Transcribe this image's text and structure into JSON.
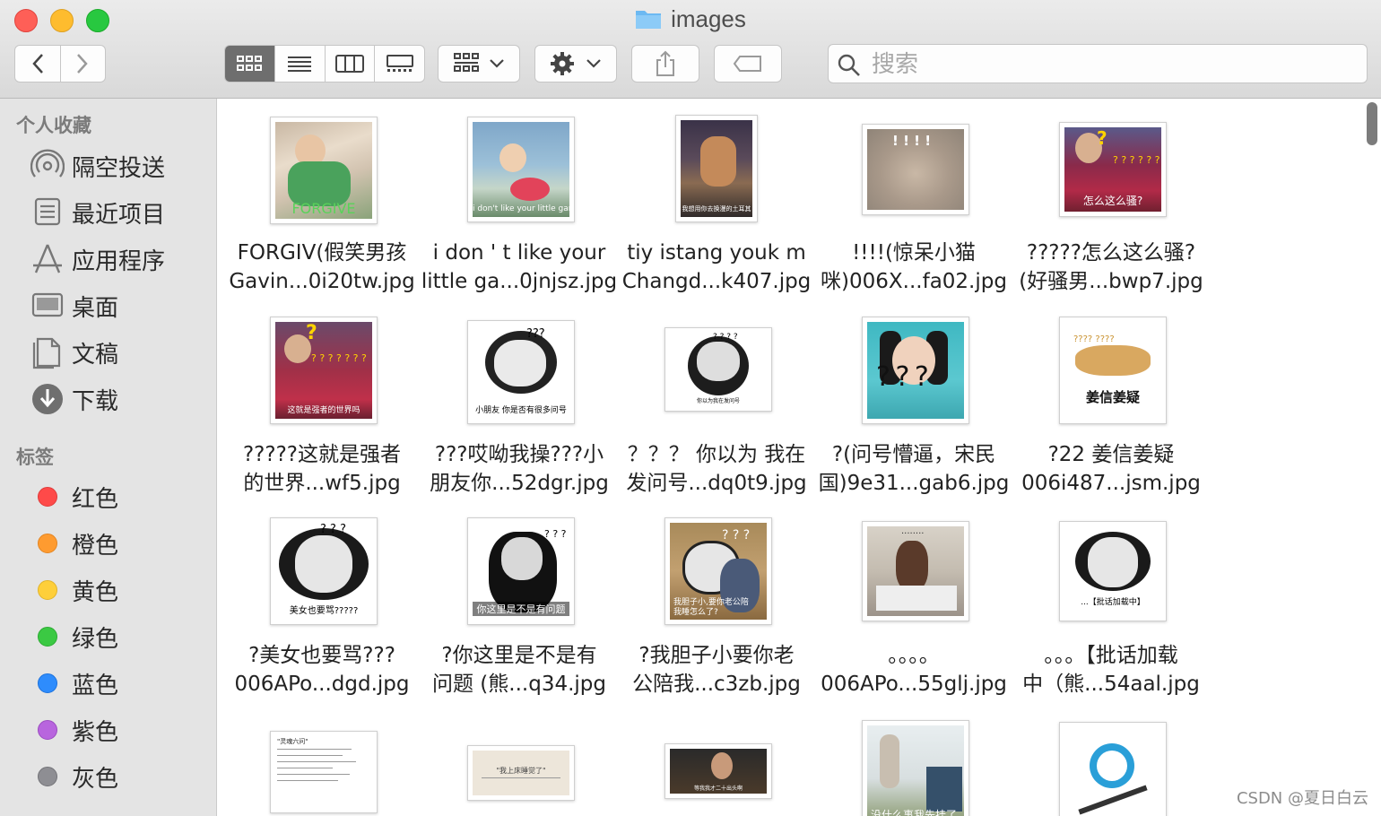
{
  "window": {
    "title": "images"
  },
  "toolbar": {
    "search": {
      "placeholder": "搜索",
      "value": ""
    },
    "view_modes": [
      "icon",
      "list",
      "column",
      "gallery"
    ],
    "active_view": "icon"
  },
  "sidebar": {
    "favorites_heading": "个人收藏",
    "favorites": [
      {
        "label": "隔空投送",
        "icon": "airdrop-icon"
      },
      {
        "label": "最近项目",
        "icon": "recents-icon"
      },
      {
        "label": "应用程序",
        "icon": "applications-icon"
      },
      {
        "label": "桌面",
        "icon": "desktop-icon"
      },
      {
        "label": "文稿",
        "icon": "documents-icon"
      },
      {
        "label": "下载",
        "icon": "downloads-icon"
      }
    ],
    "tags_heading": "标签",
    "tags": [
      {
        "label": "红色",
        "color": "#fe4a49"
      },
      {
        "label": "橙色",
        "color": "#fe9b30"
      },
      {
        "label": "黄色",
        "color": "#fecf3a"
      },
      {
        "label": "绿色",
        "color": "#3bc943"
      },
      {
        "label": "蓝色",
        "color": "#2e8cfc"
      },
      {
        "label": "紫色",
        "color": "#b865de"
      },
      {
        "label": "灰色",
        "color": "#8e8e93"
      }
    ]
  },
  "files": [
    {
      "line1": "FORGIV(假笑男孩",
      "line2": "Gavin...0i20tw.jpg",
      "caption": "FORGIVE"
    },
    {
      "line1": "i don ' t like your",
      "line2": "little ga...0jnjsz.jpg",
      "caption": "i don't like your little game"
    },
    {
      "line1": "tiy istang youk m",
      "line2": "Changd...k407.jpg",
      "caption": "我想用你去换漫的土耳其"
    },
    {
      "line1": "!!!!(惊呆小猫",
      "line2": "咪)006X...fa02.jpg",
      "caption": "! ! ! !"
    },
    {
      "line1": "?????怎么这么骚?",
      "line2": "(好骚男...bwp7.jpg",
      "caption": "怎么这么骚?"
    },
    {
      "line1": "?????这就是强者",
      "line2": "的世界...wf5.jpg",
      "caption": "这就是强者的世界吗"
    },
    {
      "line1": "???哎呦我操???小",
      "line2": "朋友你...52dgr.jpg",
      "caption": "小朋友 你是否有很多问号"
    },
    {
      "line1": "？？？ 你以为 我在",
      "line2": "发问号...dq0t9.jpg",
      "caption": "你以为我在发问号"
    },
    {
      "line1": "?(问号懵逼，宋民",
      "line2": "国)9e31...gab6.jpg",
      "caption": "? ? ?"
    },
    {
      "line1": "?22 姜信姜疑",
      "line2": "006i487...jsm.jpg",
      "caption": "姜信姜疑"
    },
    {
      "line1": "?美女也要骂???",
      "line2": "006APo...dgd.jpg",
      "caption": "美女也要骂?????"
    },
    {
      "line1": "?你这里是不是有",
      "line2": "问题 (熊...q34.jpg",
      "caption": "你这里是不是有问题"
    },
    {
      "line1": "?我胆子小要你老",
      "line2": "公陪我...c3zb.jpg",
      "caption": "我胆子小,要你老公陪我睡怎么了?"
    },
    {
      "line1": "。。。。",
      "line2": "006APo...55glj.jpg",
      "caption": "........"
    },
    {
      "line1": "。。。【批话加载",
      "line2": "中（熊...54aal.jpg",
      "caption": "...【批话加载中】"
    },
    {
      "line1": "",
      "line2": "",
      "caption": "\"灵魂六问\""
    },
    {
      "line1": "",
      "line2": "",
      "caption": "\"我上床睡觉了\""
    },
    {
      "line1": "",
      "line2": "",
      "caption": "等我我才二十出头啊"
    },
    {
      "line1": "",
      "line2": "",
      "caption": "没什么事我先挂了"
    },
    {
      "line1": "",
      "line2": "",
      "caption": ""
    }
  ],
  "watermark": "CSDN @夏日白云"
}
